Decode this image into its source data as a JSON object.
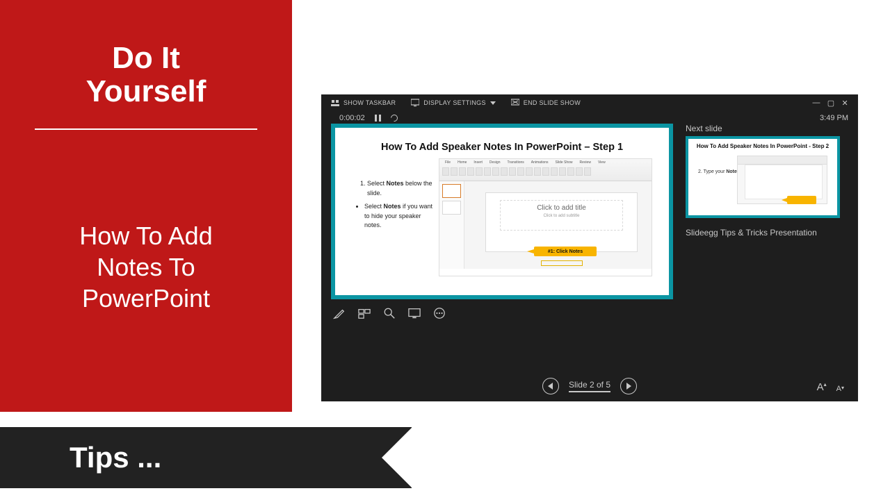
{
  "left": {
    "heading_line1": "Do It",
    "heading_line2": "Yourself",
    "subtitle_line1": "How To Add",
    "subtitle_line2": "Notes To",
    "subtitle_line3": "PowerPoint"
  },
  "ribbon": {
    "text": "Tips ..."
  },
  "presenter": {
    "toolbar": {
      "show_taskbar": "SHOW TASKBAR",
      "display_settings": "DISPLAY SETTINGS",
      "end_show": "END SLIDE SHOW"
    },
    "timer": "0:00:02",
    "clock": "3:49 PM",
    "nav": {
      "slide_of": "Slide 2 of 5"
    },
    "next_label": "Next slide",
    "presentation_title": "Slideegg Tips & Tricks Presentation"
  },
  "main_slide": {
    "title": "How To Add Speaker Notes In PowerPoint – Step 1",
    "step1a": "Select ",
    "step1b": "Notes",
    "step1c": " below the slide.",
    "step2a": "Select ",
    "step2b": "Notes",
    "step2c": " if you want to hide your speaker notes.",
    "canvas_title": "Click to add title",
    "canvas_sub": "Click to add subtitle",
    "callout": "#1: Click Notes"
  },
  "next_slide": {
    "title": "How To Add Speaker Notes In PowerPoint - Step 2",
    "text_prefix": "2. Type your ",
    "text_bold": "Notes"
  }
}
